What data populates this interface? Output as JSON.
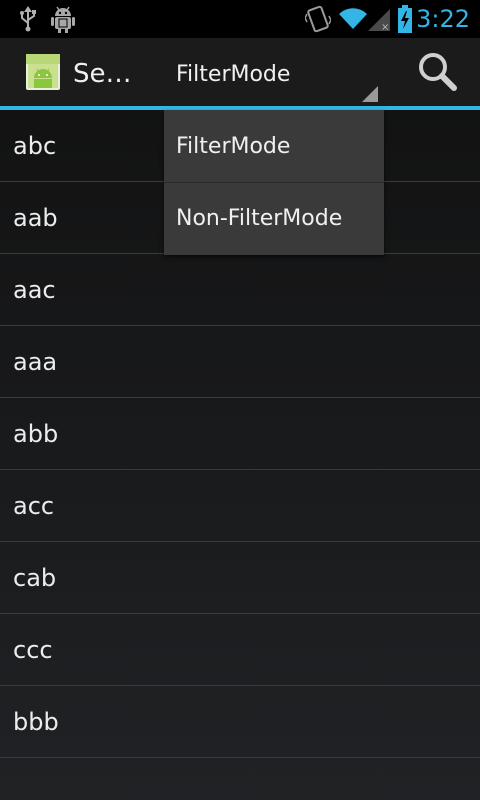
{
  "status_bar": {
    "time": "3:22",
    "accent_color": "#33b5e5",
    "icons": [
      "usb-icon",
      "debug-icon",
      "vibrate-icon",
      "wifi-icon",
      "signal-icon",
      "battery-icon"
    ]
  },
  "action_bar": {
    "title": "Se…",
    "app_icon": "android-app-icon",
    "spinner_selected": "FilterMode",
    "search_icon": "search-icon",
    "divider_color": "#33b5e5"
  },
  "dropdown": {
    "items": [
      {
        "label": "FilterMode"
      },
      {
        "label": "Non-FilterMode"
      }
    ]
  },
  "list": {
    "items": [
      {
        "label": "abc"
      },
      {
        "label": "aab"
      },
      {
        "label": "aac"
      },
      {
        "label": "aaa"
      },
      {
        "label": "abb"
      },
      {
        "label": "acc"
      },
      {
        "label": "cab"
      },
      {
        "label": "ccc"
      },
      {
        "label": "bbb"
      },
      {
        "label": ""
      }
    ]
  }
}
